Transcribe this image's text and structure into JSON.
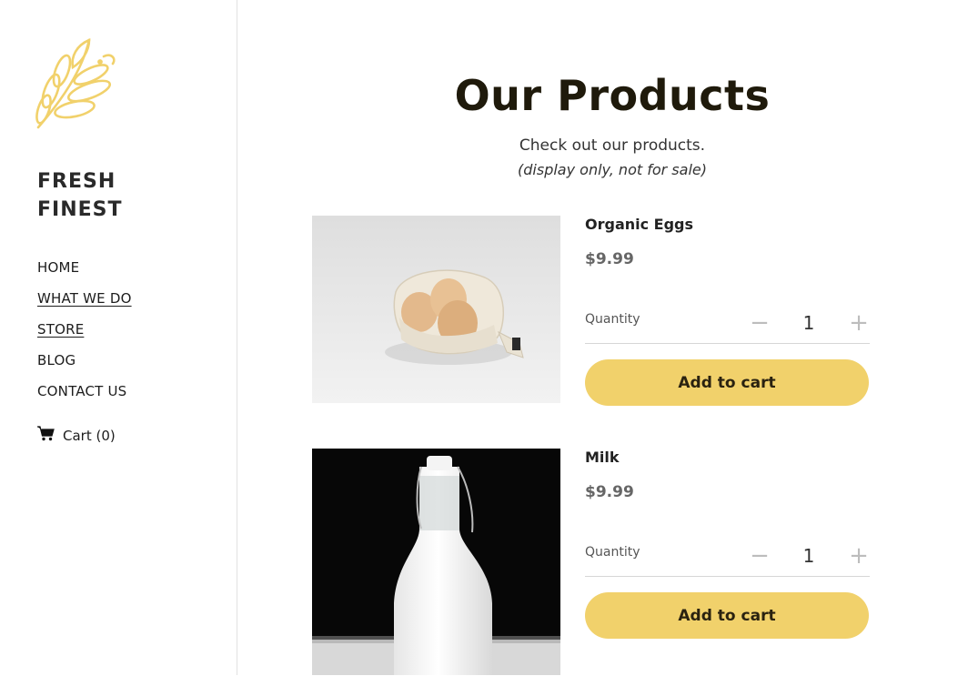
{
  "brand": {
    "line1": "FRESH",
    "line2": "FINEST",
    "logo_icon": "wheat-icon",
    "accent_color": "#f1d16b"
  },
  "nav": [
    {
      "label": "HOME",
      "underlined": false
    },
    {
      "label": "WHAT WE DO",
      "underlined": true
    },
    {
      "label": "STORE",
      "underlined": true
    },
    {
      "label": "BLOG",
      "underlined": false
    },
    {
      "label": "CONTACT US",
      "underlined": false
    }
  ],
  "cart": {
    "label": "Cart (0)",
    "icon": "cart-icon"
  },
  "header": {
    "title": "Our Products",
    "subtitle": "Check out our products.",
    "note": "(display only, not for sale)"
  },
  "products": [
    {
      "name": "Organic Eggs",
      "price": "$9.99",
      "quantity_label": "Quantity",
      "quantity": "1",
      "add_label": "Add to cart",
      "minus": "−",
      "plus": "+"
    },
    {
      "name": "Milk",
      "price": "$9.99",
      "quantity_label": "Quantity",
      "quantity": "1",
      "add_label": "Add to cart",
      "minus": "−",
      "plus": "+"
    }
  ]
}
